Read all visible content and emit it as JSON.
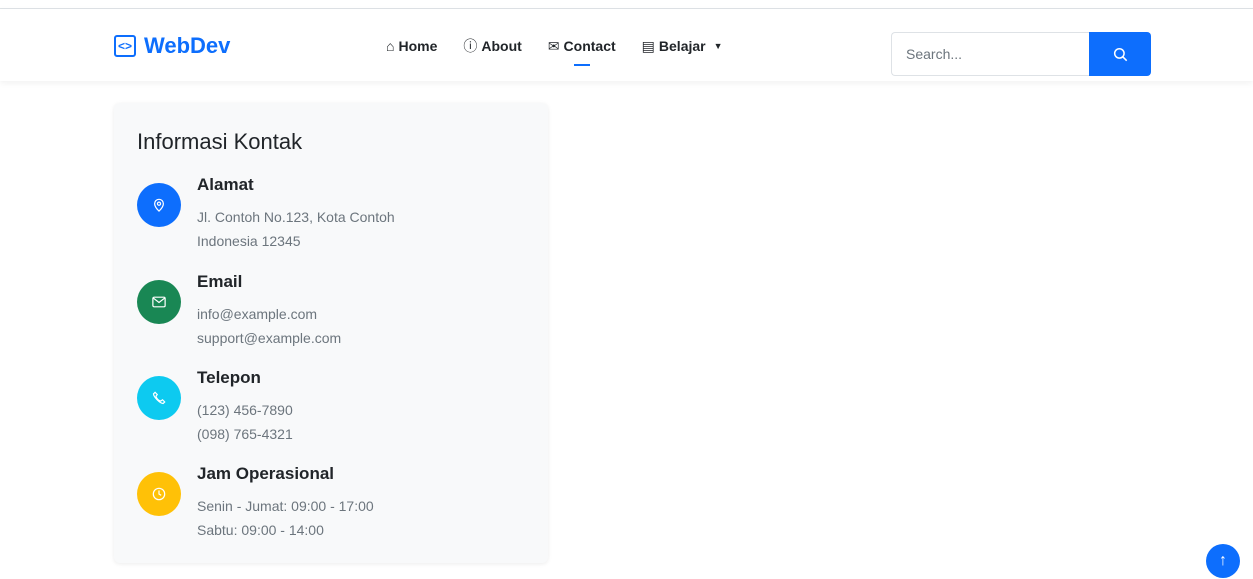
{
  "brand": {
    "name": "WebDev",
    "icon": "code-brackets-icon"
  },
  "nav": {
    "items": [
      {
        "label": "Home",
        "icon": "house-icon"
      },
      {
        "label": "About",
        "icon": "info-circle-icon"
      },
      {
        "label": "Contact",
        "icon": "envelope-icon",
        "active": true
      },
      {
        "label": "Belajar",
        "icon": "journal-icon",
        "dropdown": true
      }
    ]
  },
  "search": {
    "placeholder": "Search...",
    "icon": "search-icon"
  },
  "contact": {
    "title": "Informasi Kontak",
    "items": [
      {
        "title": "Alamat",
        "icon": "geo-pin-icon",
        "color": "#0d6efd",
        "lines": [
          "Jl. Contoh No.123, Kota Contoh",
          "Indonesia 12345"
        ]
      },
      {
        "title": "Email",
        "icon": "envelope-icon",
        "color": "#198754",
        "lines": [
          "info@example.com",
          "support@example.com"
        ]
      },
      {
        "title": "Telepon",
        "icon": "telephone-icon",
        "color": "#0dcaf0",
        "lines": [
          "(123) 456-7890",
          "(098) 765-4321"
        ]
      },
      {
        "title": "Jam Operasional",
        "icon": "clock-icon",
        "color": "#ffc107",
        "lines": [
          "Senin - Jumat: 09:00 - 17:00",
          "Sabtu: 09:00 - 14:00"
        ]
      }
    ]
  },
  "back_to_top": {
    "icon": "arrow-up-icon",
    "symbol": "↑"
  }
}
